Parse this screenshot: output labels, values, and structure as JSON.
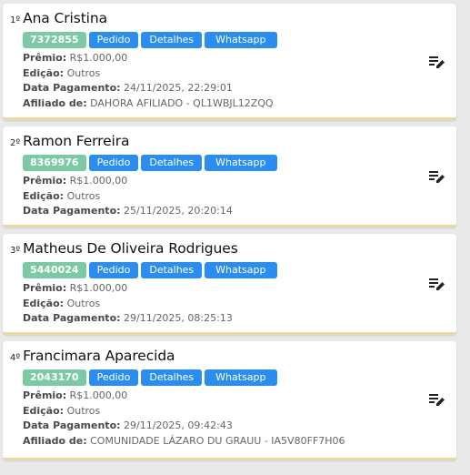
{
  "labels": {
    "premio": "Prêmio:",
    "edicao": "Edição:",
    "data_pagamento": "Data Pagamento:",
    "afiliado": "Afiliado de:",
    "pedido_button": "Pedido",
    "detalhes_button": "Detalhes",
    "whatsapp_button": "Whatsapp"
  },
  "icons": {
    "edit": "edit-note-icon"
  },
  "colors": {
    "badge": "#7ccaa3",
    "button": "#2a8df0"
  },
  "winners": [
    {
      "rank": "1º",
      "name": "Ana Cristina",
      "code": "7372855",
      "premio": "R$1.000,00",
      "edicao": "Outros",
      "data_pagamento": "24/11/2025, 22:29:01",
      "afiliado": "DAHORA AFILIADO - QL1WBJL12ZQQ"
    },
    {
      "rank": "2º",
      "name": "Ramon Ferreira",
      "code": "8369976",
      "premio": "R$1.000,00",
      "edicao": "Outros",
      "data_pagamento": "25/11/2025, 20:20:14"
    },
    {
      "rank": "3º",
      "name": "Matheus De Oliveira Rodrigues",
      "code": "5440024",
      "premio": "R$1.000,00",
      "edicao": "Outros",
      "data_pagamento": "29/11/2025, 08:25:13"
    },
    {
      "rank": "4º",
      "name": "Francimara Aparecida",
      "code": "2043170",
      "premio": "R$1.000,00",
      "edicao": "Outros",
      "data_pagamento": "29/11/2025, 09:42:43",
      "afiliado": "COMUNIDADE LÁZARO DU GRAUU - IA5V80FF7H06"
    }
  ]
}
